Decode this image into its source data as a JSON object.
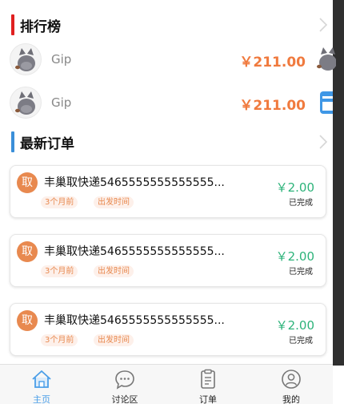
{
  "colors": {
    "rank_bar": "#e02020",
    "orders_bar": "#3a8fd9",
    "amount": "#f07a3e",
    "badge": "#e8894f",
    "price": "#2db37a",
    "tab_active": "#4a9ee8"
  },
  "ranking": {
    "title": "排行榜",
    "entries": [
      {
        "name": "Gip",
        "amount": "￥211.00",
        "avatar_icon": "cat-avatar-icon"
      },
      {
        "name": "Gip",
        "amount": "￥211.00",
        "avatar_icon": "cat-avatar-icon"
      }
    ]
  },
  "orders": {
    "title": "最新订单",
    "items": [
      {
        "badge": "取",
        "title": "丰巢取快递5465555555555555...",
        "time_ago": "3个月前",
        "time_label": "出发时间",
        "price": "￥2.00",
        "status": "已完成"
      },
      {
        "badge": "取",
        "title": "丰巢取快递5465555555555555...",
        "time_ago": "3个月前",
        "time_label": "出发时间",
        "price": "￥2.00",
        "status": "已完成"
      },
      {
        "badge": "取",
        "title": "丰巢取快递5465555555555555...",
        "time_ago": "3个月前",
        "time_label": "出发时间",
        "price": "￥2.00",
        "status": "已完成"
      }
    ]
  },
  "tabbar": {
    "active_index": 0,
    "tabs": [
      {
        "label": "主页",
        "icon": "home-icon"
      },
      {
        "label": "讨论区",
        "icon": "chat-icon"
      },
      {
        "label": "订单",
        "icon": "clipboard-icon"
      },
      {
        "label": "我的",
        "icon": "user-icon"
      }
    ]
  }
}
